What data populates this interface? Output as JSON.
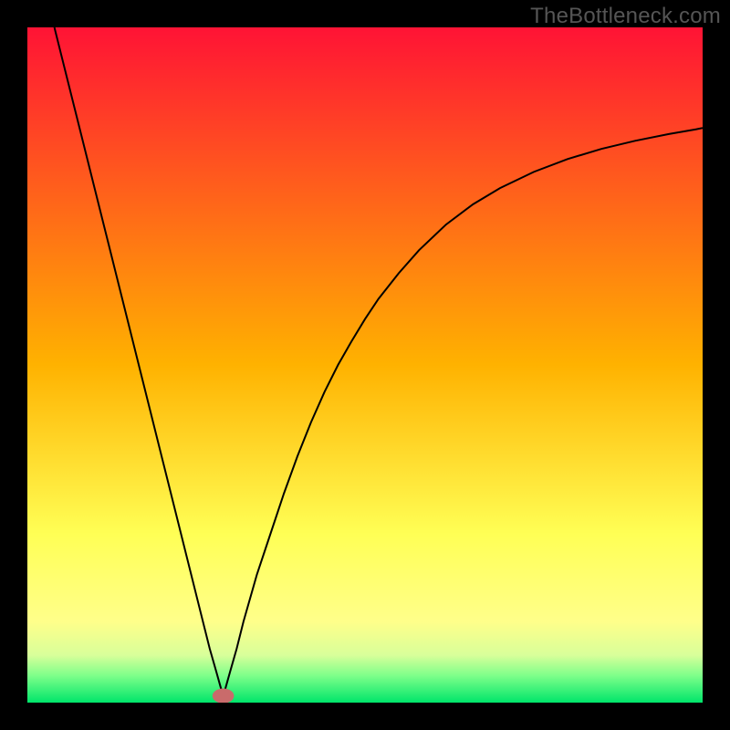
{
  "watermark": "TheBottleneck.com",
  "chart_data": {
    "type": "line",
    "title": "",
    "xlabel": "",
    "ylabel": "",
    "xlim": [
      0,
      100
    ],
    "ylim": [
      0,
      100
    ],
    "grid": false,
    "legend": false,
    "background_gradient": {
      "stops": [
        {
          "offset": 0.0,
          "color": "#ff1335"
        },
        {
          "offset": 0.5,
          "color": "#ffb200"
        },
        {
          "offset": 0.75,
          "color": "#ffff55"
        },
        {
          "offset": 0.88,
          "color": "#ffff8a"
        },
        {
          "offset": 0.93,
          "color": "#d8ff9a"
        },
        {
          "offset": 0.96,
          "color": "#7eff8a"
        },
        {
          "offset": 1.0,
          "color": "#00e56a"
        }
      ]
    },
    "marker": {
      "x": 29,
      "y": 1,
      "color": "#c96b6b",
      "rx": 1.6,
      "ry": 1.1
    },
    "series": [
      {
        "name": "curve",
        "color": "#000000",
        "width": 2.0,
        "x": [
          4,
          6,
          8,
          10,
          12,
          14,
          16,
          18,
          20,
          22,
          24,
          26,
          27,
          28,
          28.7,
          29,
          29.3,
          30,
          31,
          32,
          34,
          36,
          38,
          40,
          42,
          44,
          46,
          48,
          50,
          52,
          55,
          58,
          62,
          66,
          70,
          75,
          80,
          85,
          90,
          95,
          99,
          100
        ],
        "y": [
          100,
          92,
          84,
          76,
          68,
          60,
          52,
          44,
          36,
          28,
          20,
          12,
          8,
          4.5,
          2,
          1,
          2,
          4.5,
          8,
          12,
          19,
          25,
          31,
          36.5,
          41.5,
          46,
          50,
          53.5,
          56.8,
          59.8,
          63.6,
          67,
          70.8,
          73.8,
          76.2,
          78.6,
          80.5,
          82,
          83.2,
          84.2,
          84.9,
          85.1
        ]
      }
    ]
  }
}
